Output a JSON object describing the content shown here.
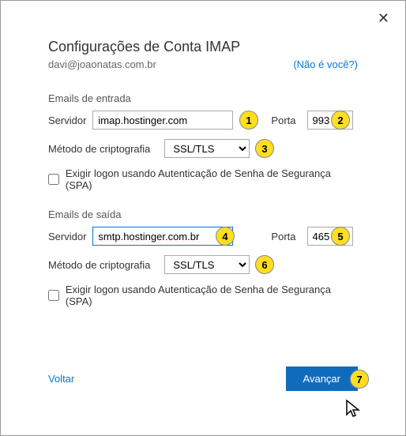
{
  "dialog": {
    "title": "Configurações de Conta IMAP",
    "email": "davi@joaonatas.com.br",
    "not_you": "(Não é você?)"
  },
  "incoming": {
    "section": "Emails de entrada",
    "server_label": "Servidor",
    "server_value": "imap.hostinger.com",
    "port_label": "Porta",
    "port_value": "993",
    "encryption_label": "Método de criptografia",
    "encryption_value": "SSL/TLS",
    "spa_label": "Exigir logon usando Autenticação de Senha de Segurança (SPA)"
  },
  "outgoing": {
    "section": "Emails de saída",
    "server_label": "Servidor",
    "server_value": "smtp.hostinger.com.br",
    "port_label": "Porta",
    "port_value": "465",
    "encryption_label": "Método de criptografia",
    "encryption_value": "SSL/TLS",
    "spa_label": "Exigir logon usando Autenticação de Senha de Segurança (SPA)"
  },
  "footer": {
    "back": "Voltar",
    "advance": "Avançar"
  },
  "badges": {
    "b1": "1",
    "b2": "2",
    "b3": "3",
    "b4": "4",
    "b5": "5",
    "b6": "6",
    "b7": "7"
  }
}
